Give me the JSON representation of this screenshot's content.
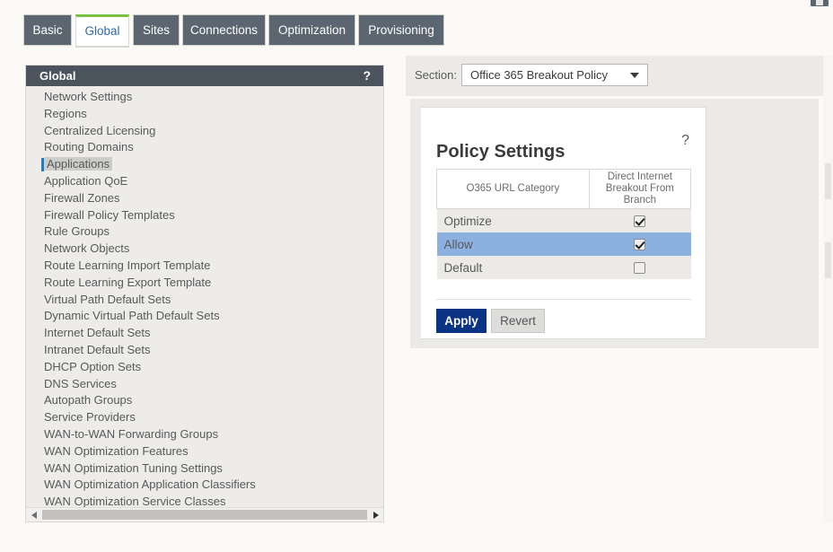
{
  "window": {
    "corner_icon": "window-restore-icon"
  },
  "tabs": [
    {
      "label": "Basic",
      "active": false
    },
    {
      "label": "Global",
      "active": true
    },
    {
      "label": "Sites",
      "active": false
    },
    {
      "label": "Connections",
      "active": false
    },
    {
      "label": "Optimization",
      "active": false
    },
    {
      "label": "Provisioning",
      "active": false
    }
  ],
  "sidebar": {
    "title": "Global",
    "help_icon": "?",
    "items": [
      {
        "label": "Network Settings",
        "selected": false
      },
      {
        "label": "Regions",
        "selected": false
      },
      {
        "label": "Centralized Licensing",
        "selected": false
      },
      {
        "label": "Routing Domains",
        "selected": false
      },
      {
        "label": "Applications",
        "selected": true
      },
      {
        "label": "Application QoE",
        "selected": false
      },
      {
        "label": "Firewall Zones",
        "selected": false
      },
      {
        "label": "Firewall Policy Templates",
        "selected": false
      },
      {
        "label": "Rule Groups",
        "selected": false
      },
      {
        "label": "Network Objects",
        "selected": false
      },
      {
        "label": "Route Learning Import Template",
        "selected": false
      },
      {
        "label": "Route Learning Export Template",
        "selected": false
      },
      {
        "label": "Virtual Path Default Sets",
        "selected": false
      },
      {
        "label": "Dynamic Virtual Path Default Sets",
        "selected": false
      },
      {
        "label": "Internet Default Sets",
        "selected": false
      },
      {
        "label": "Intranet Default Sets",
        "selected": false
      },
      {
        "label": "DHCP Option Sets",
        "selected": false
      },
      {
        "label": "DNS Services",
        "selected": false
      },
      {
        "label": "Autopath Groups",
        "selected": false
      },
      {
        "label": "Service Providers",
        "selected": false
      },
      {
        "label": "WAN-to-WAN Forwarding Groups",
        "selected": false
      },
      {
        "label": "WAN Optimization Features",
        "selected": false
      },
      {
        "label": "WAN Optimization Tuning Settings",
        "selected": false
      },
      {
        "label": "WAN Optimization Application Classifiers",
        "selected": false
      },
      {
        "label": "WAN Optimization Service Classes",
        "selected": false
      }
    ]
  },
  "section": {
    "label": "Section:",
    "selected": "Office 365 Breakout Policy",
    "caret_icon": "chevron-down-icon"
  },
  "panel": {
    "title": "Policy Settings",
    "help_icon": "?",
    "columns": [
      "O365 URL Category",
      "Direct Internet Breakout From Branch"
    ],
    "rows": [
      {
        "category": "Optimize",
        "breakout": true,
        "selected": false
      },
      {
        "category": "Allow",
        "breakout": true,
        "selected": true
      },
      {
        "category": "Default",
        "breakout": false,
        "selected": false
      }
    ],
    "apply_label": "Apply",
    "revert_label": "Revert"
  },
  "colors": {
    "tab_inactive_bg": "#5b6670",
    "tab_active_accent": "#7cc242",
    "tab_active_text": "#2c6bb0",
    "nav_header_bg": "#4b535c",
    "nav_bg": "#edece9",
    "selected_row_bg": "#8cb0e0",
    "accent_blue": "#1f7dc4",
    "apply_bg": "#0b3383"
  }
}
